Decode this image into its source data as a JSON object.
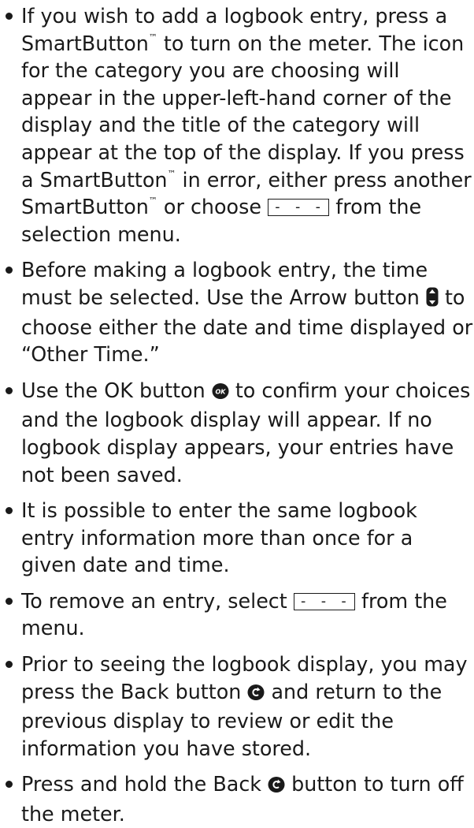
{
  "text": {
    "b1_part1": "If you wish to add a logbook entry, press a SmartButton",
    "tm": "™",
    "b1_part2": " to turn on the meter. The icon for the category you are choosing will appear in the upper-left-hand corner of the display and the title of the category will appear at the top of the display. If you press a SmartButton",
    "b1_part3": " in error, either press another SmartButton",
    "b1_part4": " or choose ",
    "dash": "- - -",
    "b1_part5": " from the selection menu.",
    "b2_part1": "Before making a logbook entry, the time must be selected. Use the Arrow button ",
    "b2_part2": " to choose either the date and time displayed or “Other Time.”",
    "b3_part1": "Use the OK button ",
    "ok_label": "OK",
    "b3_part2": " to confirm your choices and the logbook display will appear. If no logbook display appears, your entries have not been saved.",
    "b4": "It is possible to enter the same logbook entry information more than once for a given date and time.",
    "b5_part1": "To remove an entry, select ",
    "b5_part2": " from the menu.",
    "b6_part1": "Prior to seeing the logbook display, you may press the Back button ",
    "b6_part2": " and return to the previous display to review or edit the information you have stored.",
    "b7_part1": "Press and hold the Back ",
    "b7_part2": " button to turn off the meter."
  },
  "icons": [
    "arrow-button-icon",
    "ok-button-icon",
    "back-button-icon"
  ]
}
